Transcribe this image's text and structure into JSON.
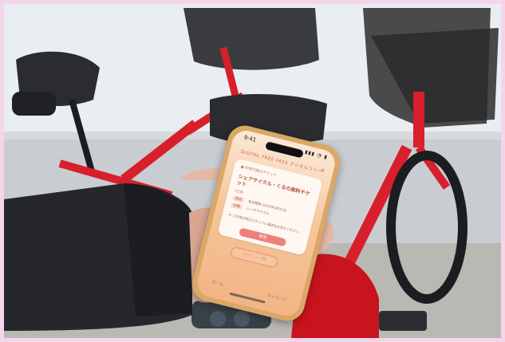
{
  "phone_screen": {
    "status_time": "9:41",
    "status_icons": "▮▮▮ ◔ ▮",
    "app_title": "DIGITAL FREE PASS  デジタルフリー",
    "close_icon": "×",
    "card_label": "● 利用可能のチケット",
    "ticket_title": "シェアサイクル・くるの無料チケット",
    "ticket_sub": "1日券",
    "row1_tag": "有効",
    "row1_value": "有効期限 2024年3月31日",
    "row2_tag": "対象",
    "row2_value": "レンタサイクル",
    "note": "※ ご利用の際はスタッフに画面をお見せください。",
    "use_button": "使用",
    "secondary_button": "チケット一覧",
    "nav_left": "ホーム",
    "nav_right": "マイページ"
  },
  "colors": {
    "frame_border": "#f4d6ea",
    "phone_frame": "#d9a865",
    "screen_top": "#fbe8d7",
    "screen_bottom": "#f2b585",
    "accent": "#ef7f7a",
    "bike_red": "#d81f2c"
  }
}
